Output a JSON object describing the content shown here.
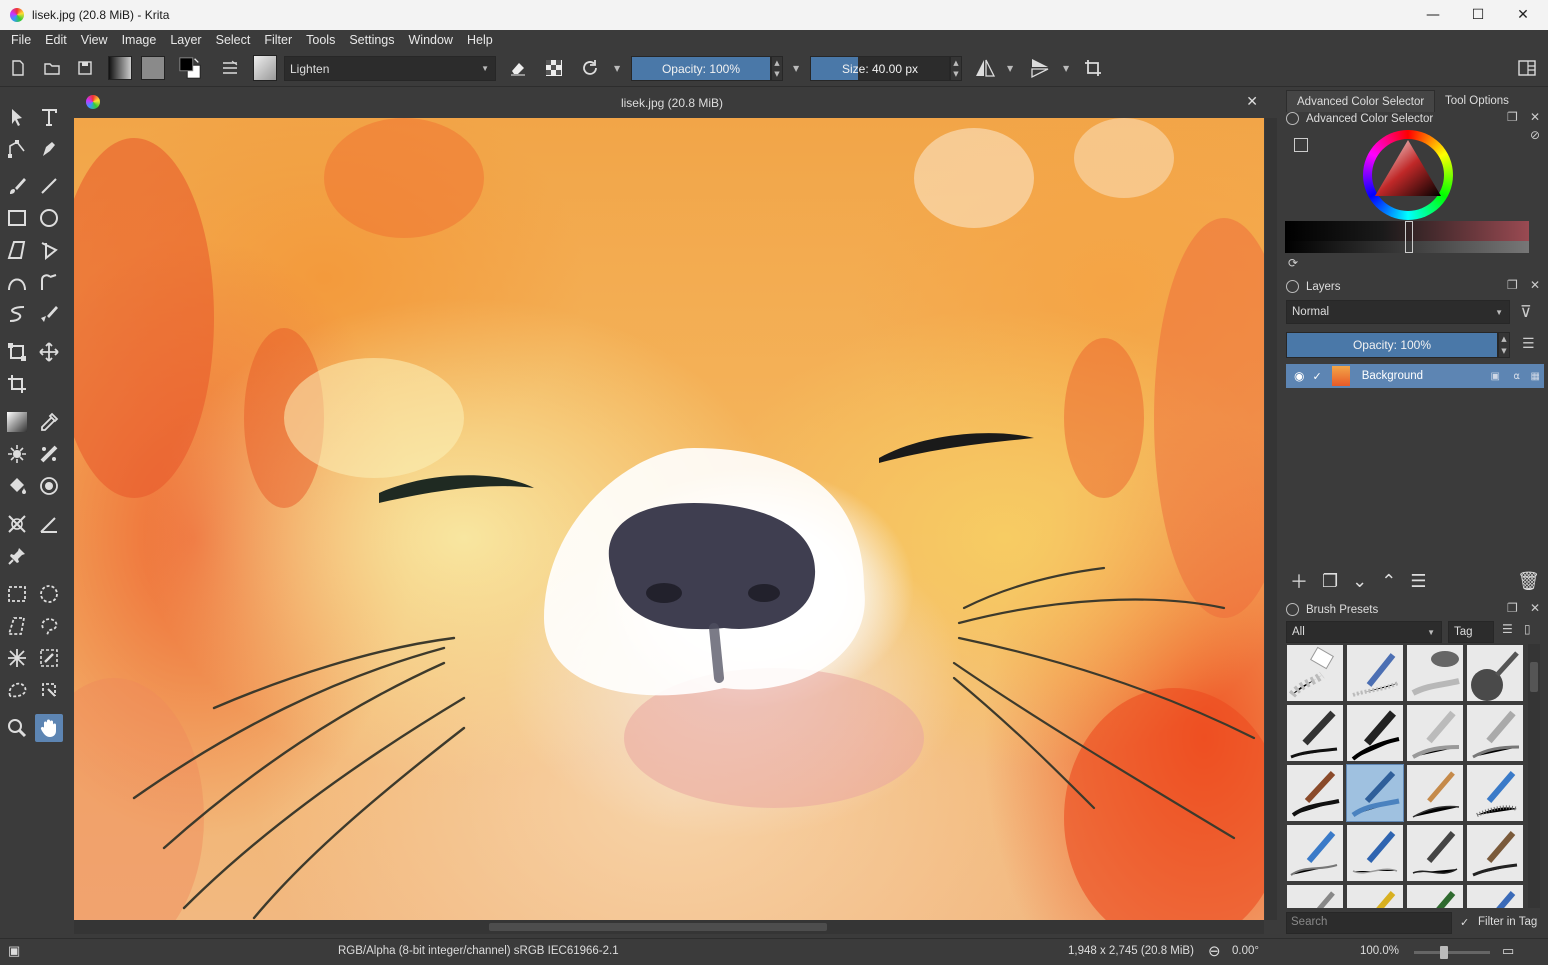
{
  "window": {
    "title": "lisek.jpg (20.8 MiB)  - Krita",
    "minimize": "—",
    "maximize": "☐",
    "close": "✕"
  },
  "menu": [
    "File",
    "Edit",
    "View",
    "Image",
    "Layer",
    "Select",
    "Filter",
    "Tools",
    "Settings",
    "Window",
    "Help"
  ],
  "toolbar": {
    "blend_mode": "Lighten",
    "opacity_label": "Opacity: 100%",
    "opacity_value": 100,
    "size_label": "Size: 40.00 px"
  },
  "document": {
    "tab_title": "lisek.jpg (20.8 MiB)",
    "close": "✕"
  },
  "dock": {
    "tabs": [
      "Advanced Color Selector",
      "Tool Options"
    ],
    "color_selector_title": "Advanced Color Selector",
    "layers": {
      "title": "Layers",
      "blend_mode": "Normal",
      "opacity_label": "Opacity:  100%",
      "layer_name": "Background"
    },
    "brush_presets": {
      "title": "Brush Presets",
      "filter": "All",
      "tag_label": "Tag",
      "search_placeholder": "Search",
      "filter_in_tag": "Filter in Tag"
    }
  },
  "status": {
    "color_space": "RGB/Alpha (8-bit integer/channel)  sRGB IEC61966-2.1",
    "dimensions": "1,948 x 2,745 (20.8 MiB)",
    "rotation": "0.00°",
    "zoom": "100.0%"
  },
  "colors": {
    "accent": "#5d85b3",
    "background": "#3b3b3b"
  }
}
